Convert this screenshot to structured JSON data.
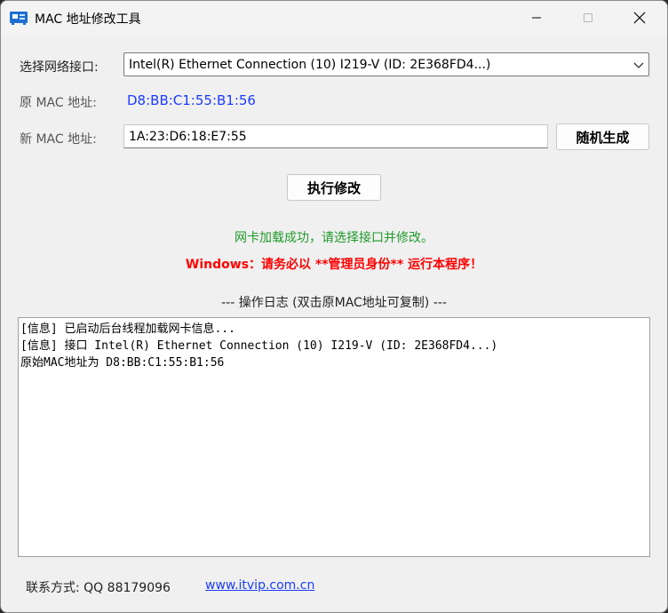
{
  "window": {
    "title": "MAC 地址修改工具",
    "controls": {
      "minimize": "minimize-icon",
      "maximize": "maximize-icon",
      "close": "close-icon"
    }
  },
  "form": {
    "interface_label": "选择网络接口:",
    "interface_value": "Intel(R) Ethernet Connection (10) I219-V (ID: 2E368FD4...)",
    "orig_mac_label": "原 MAC 地址:",
    "orig_mac_value": "D8:BB:C1:55:B1:56",
    "new_mac_label": "新 MAC 地址:",
    "new_mac_value": "1A:23:D6:18:E7:55",
    "random_button": "随机生成",
    "execute_button": "执行修改"
  },
  "status": {
    "success": "网卡加载成功，请选择接口并修改。",
    "warning": "Windows：请务必以 **管理员身份** 运行本程序！"
  },
  "log": {
    "title": "--- 操作日志 (双击原MAC地址可复制) ---",
    "lines": [
      "[信息] 已启动后台线程加载网卡信息...",
      "[信息] 接口 Intel(R) Ethernet Connection (10) I219-V (ID: 2E368FD4...)",
      "原始MAC地址为 D8:BB:C1:55:B1:56"
    ]
  },
  "footer": {
    "contact": "联系方式: QQ 88179096",
    "link": "www.itvip.com.cn"
  },
  "colors": {
    "mac_blue": "#1a3cff",
    "success_green": "#1f9a2a",
    "warning_red": "#ff0000"
  }
}
